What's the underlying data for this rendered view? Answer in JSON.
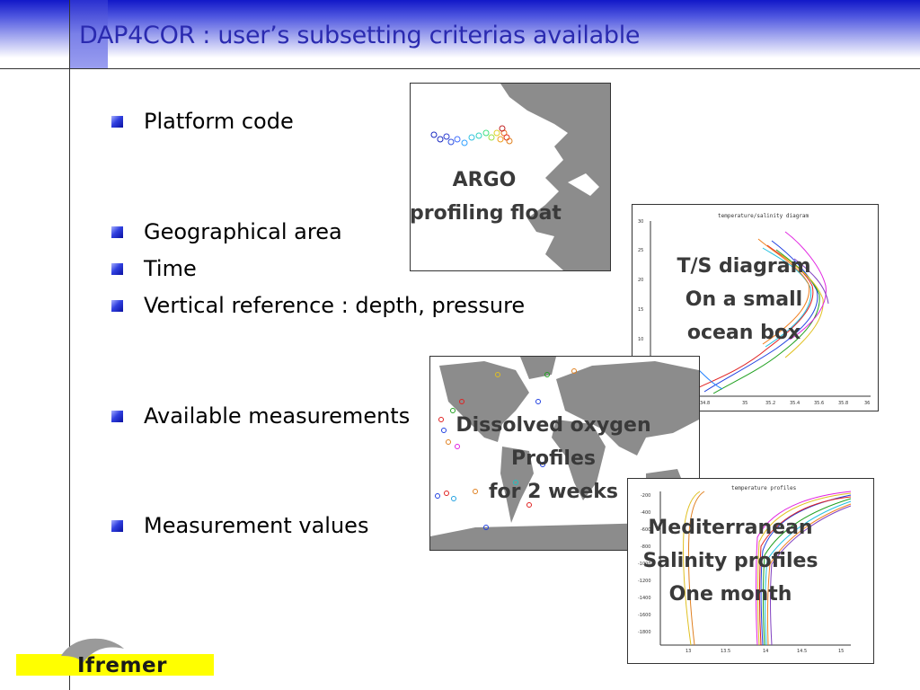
{
  "slide": {
    "title": "DAP4COR : user’s subsetting criterias available"
  },
  "bullets": [
    "Platform code",
    "Geographical area",
    "Time",
    "Vertical reference : depth, pressure",
    "Available measurements",
    "Measurement values"
  ],
  "figures": {
    "argo": {
      "caption_line1": "ARGO",
      "caption_line2": "profiling float"
    },
    "ts_diagram": {
      "caption_line1": "T/S diagram",
      "caption_line2": "On a small",
      "caption_line3": "ocean box",
      "plot_title": "temperature/salinity diagram"
    },
    "oxygen": {
      "caption_line1": "Dissolved oxygen",
      "caption_line2": "Profiles",
      "caption_line3": "for 2 weeks"
    },
    "salinity": {
      "caption_line1": "Mediterranean",
      "caption_line2": "Salinity profiles",
      "caption_line3": "One month",
      "plot_title": "temperature profiles"
    }
  },
  "logo": {
    "text": "Ifremer"
  },
  "colors": {
    "title": "#2a2ab0",
    "header_gradient_top": "#1218c8",
    "logo_bar": "#ffff00",
    "land": "#8c8c8c"
  }
}
